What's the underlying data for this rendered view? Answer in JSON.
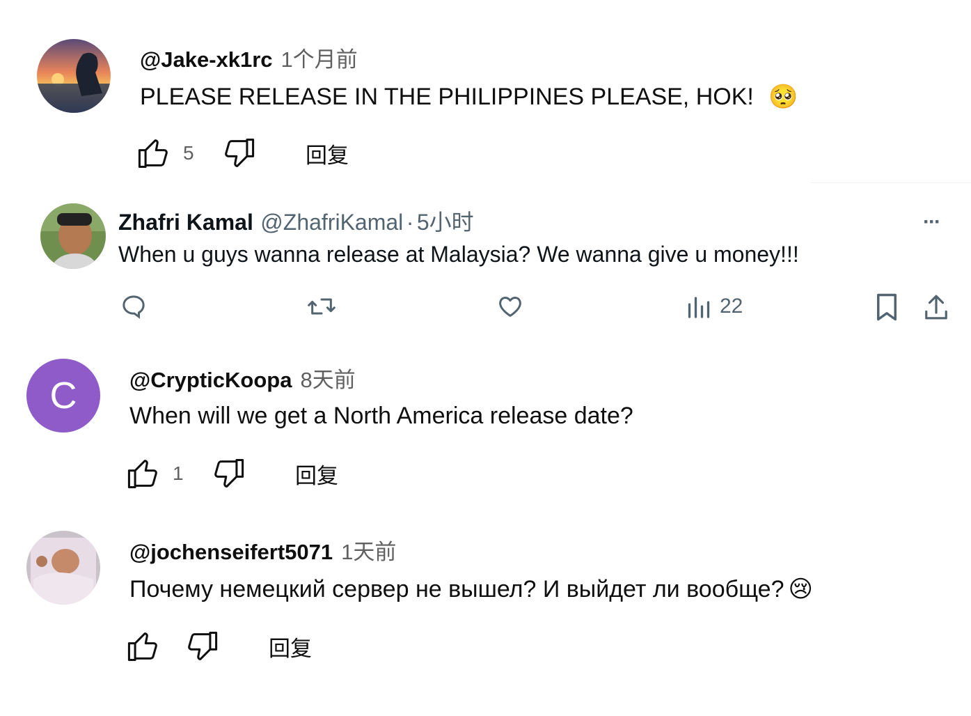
{
  "comments": [
    {
      "handle": "@Jake-xk1rc",
      "time": "1个月前",
      "text": "PLEASE RELEASE IN THE PHILIPPINES PLEASE, HOK!",
      "emoji": "🥺",
      "likes": "5",
      "reply": "回复"
    },
    {
      "handle": "@CrypticKoopa",
      "time": "8天前",
      "text": "When will we get a North America release date?",
      "avatar_letter": "C",
      "avatar_color": "#8e5bc9",
      "likes": "1",
      "reply": "回复"
    },
    {
      "handle": "@jochenseifert5071",
      "time": "1天前",
      "text": "Почему немецкий сервер не вышел? И выйдет ли вообще?",
      "emoji": "😢",
      "likes": "",
      "reply": "回复"
    }
  ],
  "tweet": {
    "name": "Zhafri Kamal",
    "handle": "@ZhafriKamal",
    "separator": "·",
    "time": "5小时",
    "text": "When u guys wanna release at Malaysia? We wanna give u money!!!",
    "views": "22",
    "more": "···"
  },
  "colors": {
    "text_primary": "#0f0f0f",
    "text_secondary": "#606060",
    "x_secondary": "#536471"
  }
}
